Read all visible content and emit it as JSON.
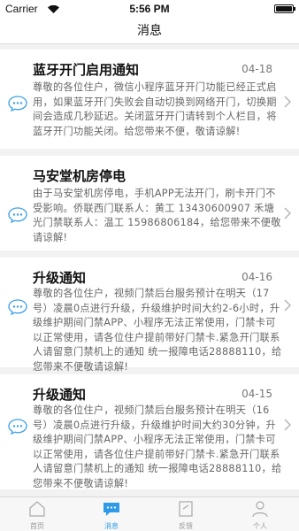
{
  "status_bar": {
    "carrier": "Carrier",
    "time": "5:56 PM"
  },
  "nav": {
    "title": "消息"
  },
  "messages": [
    {
      "title": "蓝牙开门启用通知",
      "date": "04-18",
      "body": "尊敬的各位住户，微信小程序蓝牙开门功能已经正式启用，如果蓝牙开门失败会自动切换到网络开门，切换期间会造成几秒延迟。关闭蓝牙开门请转到个人栏目，将蓝牙开门功能关闭。给您带来不便，敬请谅解!"
    },
    {
      "title": "马安堂机房停电",
      "date": "04-18",
      "body": "由于马安堂机房停电，手机APP无法开门，刷卡开门不受影响。侨联西门联系人：黄工 13430600907 禾塘光门禁联系人：温工 15986806184，给您带来不便敬请谅解!"
    },
    {
      "title": "升级通知",
      "date": "04-16",
      "body": "尊敬的各位住户，视频门禁后台服务预计在明天（17号）凌晨0点进行升级，升级维护时间大约2-6小时，升级维护期间门禁APP、小程序无法正常使用，门禁卡可以正常使用，请各位住户提前带好门禁卡.紧急开门联系人请留意门禁机上的通知 统一报障电话28888110，给您带来不便敬请谅解!"
    },
    {
      "title": "升级通知",
      "date": "04-15",
      "body": "尊敬的各位住户，视频门禁后台服务预计在明天（16号）凌晨0点进行升级，升级维护时间大约30分钟，升级维护期间门禁APP、小程序无法正常使用，门禁卡可以正常使用，请各位住户提前带好门禁卡.紧急开门联系人请留意门禁机上的通知 统一报障电话28888110，给您带来不便敬请谅解!"
    }
  ],
  "tabs": [
    {
      "label": "首页",
      "icon": "home-icon",
      "active": false
    },
    {
      "label": "消息",
      "icon": "message-icon",
      "active": true
    },
    {
      "label": "反馈",
      "icon": "feedback-icon",
      "active": false
    },
    {
      "label": "个人",
      "icon": "person-icon",
      "active": false
    }
  ],
  "colors": {
    "accent": "#2f9be8",
    "inactive": "#999999",
    "background": "#f2f2f2"
  }
}
